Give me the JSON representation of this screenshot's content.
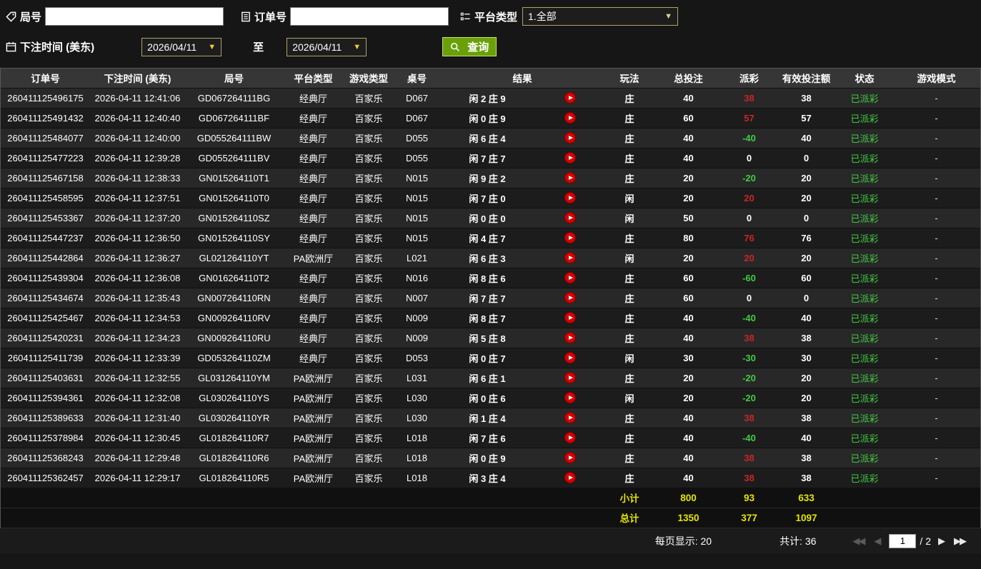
{
  "colors": {
    "win_payout_red": "#cc2525",
    "loss_payout_green": "#43cb43",
    "status_paid_green": "#43c943",
    "summary_yellow": "#e5e500",
    "query_button_green": "#6aa10a",
    "filter_border_tan": "#b0a266"
  },
  "icons": {
    "dropdown_arrow": "▼",
    "first_page": "◀◀",
    "prev_page": "◀",
    "next_page": "▶",
    "last_page": "▶▶"
  },
  "filters": {
    "game_no": {
      "label": "局号",
      "value": "",
      "placeholder": ""
    },
    "order_no": {
      "label": "订单号",
      "value": "",
      "placeholder": ""
    },
    "platform": {
      "label": "平台类型",
      "selected": "1.全部"
    },
    "bet_time": {
      "label": "下注时间 (美东)",
      "from": "2026/04/11",
      "to_label": "至",
      "to": "2026/04/11"
    },
    "query_button_label": "查询"
  },
  "table": {
    "headers": [
      "订单号",
      "下注时间 (美东)",
      "局号",
      "平台类型",
      "游戏类型",
      "桌号",
      "结果",
      "玩法",
      "总投注",
      "派彩",
      "有效投注额",
      "状态",
      "游戏模式"
    ],
    "rows": [
      [
        "260411125496175",
        "2026-04-11 12:41:06",
        "GD067264111BG",
        "经典厅",
        "百家乐",
        "D067",
        "闲 2 庄 9",
        "庄",
        "40",
        "38",
        "38",
        "已派彩",
        "-"
      ],
      [
        "260411125491432",
        "2026-04-11 12:40:40",
        "GD067264111BF",
        "经典厅",
        "百家乐",
        "D067",
        "闲 0 庄 9",
        "庄",
        "60",
        "57",
        "57",
        "已派彩",
        "-"
      ],
      [
        "260411125484077",
        "2026-04-11 12:40:00",
        "GD055264111BW",
        "经典厅",
        "百家乐",
        "D055",
        "闲 6 庄 4",
        "庄",
        "40",
        "-40",
        "40",
        "已派彩",
        "-"
      ],
      [
        "260411125477223",
        "2026-04-11 12:39:28",
        "GD055264111BV",
        "经典厅",
        "百家乐",
        "D055",
        "闲 7 庄 7",
        "庄",
        "40",
        "0",
        "0",
        "已派彩",
        "-"
      ],
      [
        "260411125467158",
        "2026-04-11 12:38:33",
        "GN015264110T1",
        "经典厅",
        "百家乐",
        "N015",
        "闲 9 庄 2",
        "庄",
        "20",
        "-20",
        "20",
        "已派彩",
        "-"
      ],
      [
        "260411125458595",
        "2026-04-11 12:37:51",
        "GN015264110T0",
        "经典厅",
        "百家乐",
        "N015",
        "闲 7 庄 0",
        "闲",
        "20",
        "20",
        "20",
        "已派彩",
        "-"
      ],
      [
        "260411125453367",
        "2026-04-11 12:37:20",
        "GN015264110SZ",
        "经典厅",
        "百家乐",
        "N015",
        "闲 0 庄 0",
        "闲",
        "50",
        "0",
        "0",
        "已派彩",
        "-"
      ],
      [
        "260411125447237",
        "2026-04-11 12:36:50",
        "GN015264110SY",
        "经典厅",
        "百家乐",
        "N015",
        "闲 4 庄 7",
        "庄",
        "80",
        "76",
        "76",
        "已派彩",
        "-"
      ],
      [
        "260411125442864",
        "2026-04-11 12:36:27",
        "GL021264110YT",
        "PA欧洲厅",
        "百家乐",
        "L021",
        "闲 6 庄 3",
        "闲",
        "20",
        "20",
        "20",
        "已派彩",
        "-"
      ],
      [
        "260411125439304",
        "2026-04-11 12:36:08",
        "GN016264110T2",
        "经典厅",
        "百家乐",
        "N016",
        "闲 8 庄 6",
        "庄",
        "60",
        "-60",
        "60",
        "已派彩",
        "-"
      ],
      [
        "260411125434674",
        "2026-04-11 12:35:43",
        "GN007264110RN",
        "经典厅",
        "百家乐",
        "N007",
        "闲 7 庄 7",
        "庄",
        "60",
        "0",
        "0",
        "已派彩",
        "-"
      ],
      [
        "260411125425467",
        "2026-04-11 12:34:53",
        "GN009264110RV",
        "经典厅",
        "百家乐",
        "N009",
        "闲 8 庄 7",
        "庄",
        "40",
        "-40",
        "40",
        "已派彩",
        "-"
      ],
      [
        "260411125420231",
        "2026-04-11 12:34:23",
        "GN009264110RU",
        "经典厅",
        "百家乐",
        "N009",
        "闲 5 庄 8",
        "庄",
        "40",
        "38",
        "38",
        "已派彩",
        "-"
      ],
      [
        "260411125411739",
        "2026-04-11 12:33:39",
        "GD053264110ZM",
        "经典厅",
        "百家乐",
        "D053",
        "闲 0 庄 7",
        "闲",
        "30",
        "-30",
        "30",
        "已派彩",
        "-"
      ],
      [
        "260411125403631",
        "2026-04-11 12:32:55",
        "GL031264110YM",
        "PA欧洲厅",
        "百家乐",
        "L031",
        "闲 6 庄 1",
        "庄",
        "20",
        "-20",
        "20",
        "已派彩",
        "-"
      ],
      [
        "260411125394361",
        "2026-04-11 12:32:08",
        "GL030264110YS",
        "PA欧洲厅",
        "百家乐",
        "L030",
        "闲 0 庄 6",
        "闲",
        "20",
        "-20",
        "20",
        "已派彩",
        "-"
      ],
      [
        "260411125389633",
        "2026-04-11 12:31:40",
        "GL030264110YR",
        "PA欧洲厅",
        "百家乐",
        "L030",
        "闲 1 庄 4",
        "庄",
        "40",
        "38",
        "38",
        "已派彩",
        "-"
      ],
      [
        "260411125378984",
        "2026-04-11 12:30:45",
        "GL018264110R7",
        "PA欧洲厅",
        "百家乐",
        "L018",
        "闲 7 庄 6",
        "庄",
        "40",
        "-40",
        "40",
        "已派彩",
        "-"
      ],
      [
        "260411125368243",
        "2026-04-11 12:29:48",
        "GL018264110R6",
        "PA欧洲厅",
        "百家乐",
        "L018",
        "闲 0 庄 9",
        "庄",
        "40",
        "38",
        "38",
        "已派彩",
        "-"
      ],
      [
        "260411125362457",
        "2026-04-11 12:29:17",
        "GL018264110R5",
        "PA欧洲厅",
        "百家乐",
        "L018",
        "闲 3 庄 4",
        "庄",
        "40",
        "38",
        "38",
        "已派彩",
        "-"
      ]
    ]
  },
  "summary": {
    "subtotal_label": "小计",
    "subtotal_total_bet": "800",
    "subtotal_payout": "93",
    "subtotal_valid_bet": "633",
    "total_label": "总计",
    "total_total_bet": "1350",
    "total_payout": "377",
    "total_valid_bet": "1097"
  },
  "pagination": {
    "per_page_label": "每页显示:",
    "per_page_value": "20",
    "total_count_label": "共计:",
    "total_count_value": "36",
    "current_page": "1",
    "page_separator": "/",
    "total_pages": "2"
  }
}
